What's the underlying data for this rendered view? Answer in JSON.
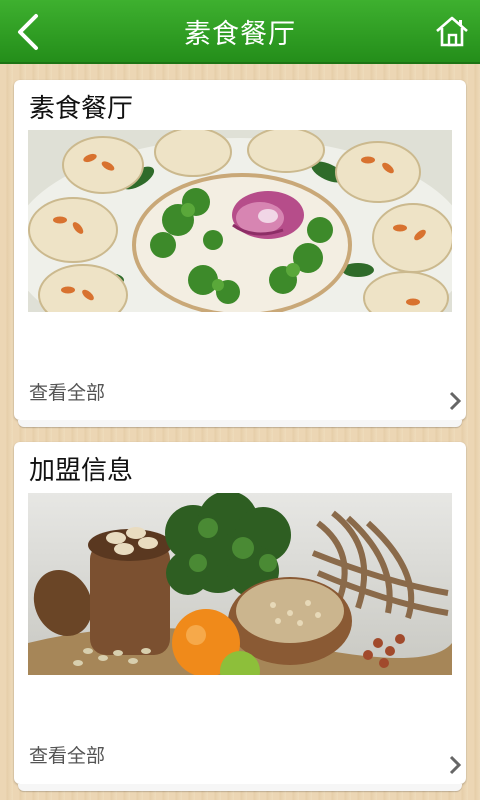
{
  "header": {
    "title": "素食餐厅"
  },
  "cards": [
    {
      "title": "素食餐厅",
      "more_label": "查看全部"
    },
    {
      "title": "加盟信息",
      "more_label": "查看全部"
    }
  ],
  "colors": {
    "header_green": "#2e9e22",
    "background_wood": "#ecd6b4"
  },
  "icons": {
    "back": "back-arrow-icon",
    "home": "home-icon",
    "chevron": "chevron-right-icon"
  }
}
